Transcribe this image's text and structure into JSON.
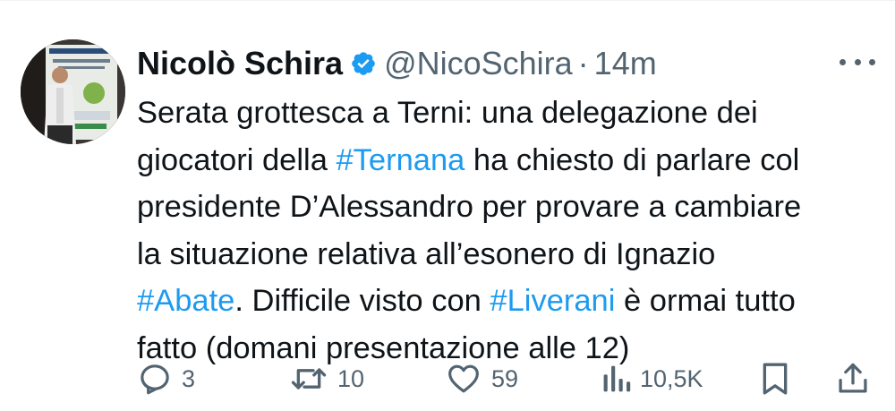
{
  "user": {
    "name": "Nicolò Schira",
    "handle": "@NicoSchira",
    "separator": "·",
    "time": "14m"
  },
  "tweet": {
    "lines": [
      [
        {
          "text": "Serata grottesca a Terni: una delegazione dei",
          "hashtag": false
        }
      ],
      [
        {
          "text": "giocatori della ",
          "hashtag": false
        },
        {
          "text": "#Ternana",
          "hashtag": true
        },
        {
          "text": " ha chiesto di parlare col",
          "hashtag": false
        }
      ],
      [
        {
          "text": "presidente D’Alessandro per provare a cambiare",
          "hashtag": false
        }
      ],
      [
        {
          "text": "la situazione relativa all’esonero di Ignazio",
          "hashtag": false
        }
      ],
      [
        {
          "text": "#Abate",
          "hashtag": true
        },
        {
          "text": ". Difficile visto con ",
          "hashtag": false
        },
        {
          "text": "#Liverani",
          "hashtag": true
        },
        {
          "text": " è ormai tutto",
          "hashtag": false
        }
      ],
      [
        {
          "text": "fatto (domani presentazione alle 12)",
          "hashtag": false
        }
      ]
    ]
  },
  "actions": {
    "replies": "3",
    "retweets": "10",
    "likes": "59",
    "views": "10,5K"
  },
  "icons": {
    "verified": "verified-badge-icon",
    "more": "more-options-icon",
    "reply": "reply-icon",
    "retweet": "retweet-icon",
    "like": "heart-icon",
    "views": "views-chart-icon",
    "bookmark": "bookmark-icon",
    "share": "share-icon"
  },
  "colors": {
    "text": "#0f1419",
    "secondary": "#536471",
    "accent": "#1d9bf0"
  }
}
